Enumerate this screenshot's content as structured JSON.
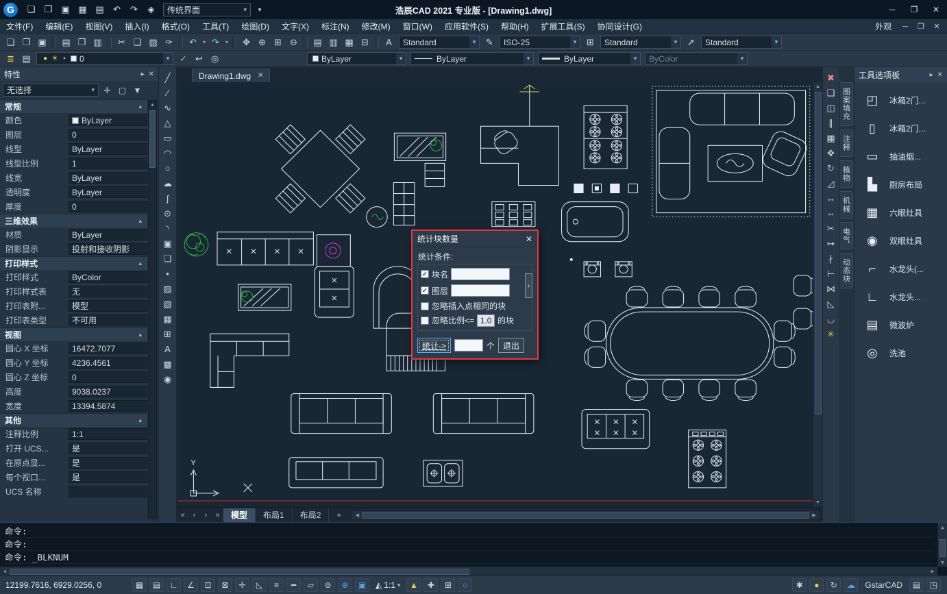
{
  "app": {
    "logo_letter": "G",
    "title": "浩辰CAD 2021 专业版 - [Drawing1.dwg]",
    "workspace": "传统界面"
  },
  "colors": {
    "accent_blue": "#2f80d0",
    "dialog_border_red": "#e03a3a",
    "canvas_background": "#192735",
    "canvas_line": "#e6edf4",
    "plant_green": "#2fae3c",
    "swirl_magenta": "#c03cc0",
    "status_bulb_yellow": "#f2cf4a",
    "red_line": "#cc2a2a"
  },
  "glyphs": {
    "chevron_down": "▾",
    "chevron_up": "▴",
    "close": "✕",
    "minimize": "─",
    "maximize": "❐",
    "pin": "▸",
    "overflow": "▾",
    "check": "✓",
    "expand": "›",
    "up": "▲",
    "down": "▼",
    "left": "◀",
    "right": "▶"
  },
  "titlebar_icons": [
    {
      "name": "new-file-icon",
      "glyph": "❏"
    },
    {
      "name": "open-file-icon",
      "glyph": "❐"
    },
    {
      "name": "save-icon",
      "glyph": "▣"
    },
    {
      "name": "save-as-icon",
      "glyph": "▦"
    },
    {
      "name": "plot-icon",
      "glyph": "▤"
    },
    {
      "name": "undo-icon",
      "glyph": "↶"
    },
    {
      "name": "redo-icon",
      "glyph": "↷"
    },
    {
      "name": "workspace-icon",
      "glyph": "◈"
    }
  ],
  "menubar": {
    "items": [
      "文件(F)",
      "编辑(E)",
      "视图(V)",
      "插入(I)",
      "格式(O)",
      "工具(T)",
      "绘图(D)",
      "文字(X)",
      "标注(N)",
      "修改(M)",
      "窗口(W)",
      "应用软件(S)",
      "帮助(H)",
      "扩展工具(S)",
      "协同设计(G)"
    ],
    "right_label": "外观"
  },
  "toolbar1": {
    "icons": [
      {
        "name": "new-file-icon",
        "glyph": "❏"
      },
      {
        "name": "open-file-icon",
        "glyph": "❐"
      },
      {
        "name": "save-icon",
        "glyph": "▣"
      },
      {
        "name": "toolbar-separator",
        "glyph": "",
        "cls": "sep"
      },
      {
        "name": "plot-icon",
        "glyph": "▤"
      },
      {
        "name": "plot-preview-icon",
        "glyph": "❒"
      },
      {
        "name": "publish-icon",
        "glyph": "▥"
      },
      {
        "name": "toolbar-separator",
        "glyph": "",
        "cls": "sep"
      },
      {
        "name": "cut-icon",
        "glyph": "✂"
      },
      {
        "name": "copy-icon",
        "glyph": "❑"
      },
      {
        "name": "paste-icon",
        "glyph": "▨"
      },
      {
        "name": "match-properties-icon",
        "glyph": "✑"
      },
      {
        "name": "toolbar-separator",
        "glyph": "",
        "cls": "sep"
      },
      {
        "name": "undo-icon",
        "glyph": "↶",
        "color": "#8fd0f0"
      },
      {
        "name": "undo-dropdown-icon",
        "glyph": "▾",
        "cls": "tiny"
      },
      {
        "name": "redo-icon",
        "glyph": "↷",
        "color": "#8fd0f0"
      },
      {
        "name": "redo-dropdown-icon",
        "glyph": "▾",
        "cls": "tiny"
      },
      {
        "name": "toolbar-separator",
        "glyph": "",
        "cls": "sep"
      },
      {
        "name": "pan-icon",
        "glyph": "✥"
      },
      {
        "name": "zoom-realtime-icon",
        "glyph": "⊕"
      },
      {
        "name": "zoom-window-icon",
        "glyph": "⊞"
      },
      {
        "name": "zoom-previous-icon",
        "glyph": "⊖"
      },
      {
        "name": "toolbar-separator",
        "glyph": "",
        "cls": "sep"
      },
      {
        "name": "properties-palette-icon",
        "glyph": "▤"
      },
      {
        "name": "tool-palettes-icon",
        "glyph": "▥"
      },
      {
        "name": "design-center-icon",
        "glyph": "▦"
      },
      {
        "name": "quick-calc-icon",
        "glyph": "⊟"
      },
      {
        "name": "toolbar-separator",
        "glyph": "",
        "cls": "sep"
      }
    ],
    "combos": [
      {
        "name": "text-style-combo",
        "icon_name": "text-style-icon",
        "icon": "A",
        "value": "Standard"
      },
      {
        "name": "dim-style-combo",
        "icon_name": "dim-style-icon",
        "icon": "✎",
        "value": "ISO-25"
      },
      {
        "name": "table-style-combo",
        "icon_name": "table-style-icon",
        "icon": "⊞",
        "value": "Standard"
      },
      {
        "name": "mleader-style-combo",
        "icon_name": "mleader-style-icon",
        "icon": "➚",
        "value": "Standard"
      }
    ]
  },
  "toolbar2": {
    "icons_left": [
      {
        "name": "layer-properties-icon",
        "glyph": "≣",
        "color": "#e8c85a"
      },
      {
        "name": "layer-states-icon",
        "glyph": "▤"
      }
    ],
    "layer_combo": {
      "bulb_icon": "●",
      "sun_icon": "☀",
      "lock_icon": "▪",
      "value": "0"
    },
    "icons_mid": [
      {
        "name": "make-object-layer-current-icon",
        "glyph": "✓",
        "color": "#7ac87a"
      },
      {
        "name": "layer-previous-icon",
        "glyph": "↩"
      },
      {
        "name": "layer-isolate-icon",
        "glyph": "◎"
      }
    ],
    "color_combo": {
      "value": "ByLayer"
    },
    "linetype_combo": {
      "value": "ByLayer"
    },
    "lineweight_combo": {
      "value": "ByLayer"
    },
    "plotstyle_combo": {
      "value": "ByColor"
    }
  },
  "properties": {
    "title": "特性",
    "selection": "无选择",
    "selector_icons": [
      {
        "name": "toggle-pickadd-icon",
        "glyph": "✛"
      },
      {
        "name": "select-objects-icon",
        "glyph": "▢"
      },
      {
        "name": "quick-select-icon",
        "glyph": "▼"
      }
    ],
    "sections": [
      {
        "title": "常规",
        "rows": [
          {
            "label": "颜色",
            "value": "ByLayer"
          },
          {
            "label": "图层",
            "value": "0"
          },
          {
            "label": "线型",
            "value": "ByLayer"
          },
          {
            "label": "线型比例",
            "value": "1"
          },
          {
            "label": "线宽",
            "value": "ByLayer"
          },
          {
            "label": "透明度",
            "value": "ByLayer"
          },
          {
            "label": "厚度",
            "value": "0"
          }
        ]
      },
      {
        "title": "三维效果",
        "rows": [
          {
            "label": "材质",
            "value": "ByLayer"
          },
          {
            "label": "阴影显示",
            "value": "投射和接收阴影"
          }
        ]
      },
      {
        "title": "打印样式",
        "rows": [
          {
            "label": "打印样式",
            "value": "ByColor"
          },
          {
            "label": "打印样式表",
            "value": "无"
          },
          {
            "label": "打印表附...",
            "value": "模型"
          },
          {
            "label": "打印表类型",
            "value": "不可用"
          }
        ]
      },
      {
        "title": "视图",
        "rows": [
          {
            "label": "圆心 X 坐标",
            "value": "16472.7077"
          },
          {
            "label": "圆心 Y 坐标",
            "value": "4236.4561"
          },
          {
            "label": "圆心 Z 坐标",
            "value": "0"
          },
          {
            "label": "高度",
            "value": "9038.0237"
          },
          {
            "label": "宽度",
            "value": "13394.5874"
          }
        ]
      },
      {
        "title": "其他",
        "rows": [
          {
            "label": "注释比例",
            "value": "1:1"
          },
          {
            "label": "打开 UCS...",
            "value": "是"
          },
          {
            "label": "在原点显...",
            "value": "是"
          },
          {
            "label": "每个视口...",
            "value": "是"
          },
          {
            "label": "UCS 名称",
            "value": ""
          }
        ]
      }
    ]
  },
  "draw_toolbar": [
    {
      "name": "line-icon",
      "glyph": "╱"
    },
    {
      "name": "construction-line-icon",
      "glyph": "∕"
    },
    {
      "name": "polyline-icon",
      "glyph": "∿"
    },
    {
      "name": "polygon-icon",
      "glyph": "△"
    },
    {
      "name": "rectangle-icon",
      "glyph": "▭"
    },
    {
      "name": "arc-icon",
      "glyph": "◠"
    },
    {
      "name": "circle-icon",
      "glyph": "○"
    },
    {
      "name": "revision-cloud-icon",
      "glyph": "☁"
    },
    {
      "name": "spline-icon",
      "glyph": "∫"
    },
    {
      "name": "ellipse-icon",
      "glyph": "⊙"
    },
    {
      "name": "ellipse-arc-icon",
      "glyph": "◝"
    },
    {
      "name": "insert-block-icon",
      "glyph": "▣"
    },
    {
      "name": "make-block-icon",
      "glyph": "❏"
    },
    {
      "name": "point-icon",
      "glyph": "•"
    },
    {
      "name": "hatch-icon",
      "glyph": "▨"
    },
    {
      "name": "gradient-icon",
      "glyph": "▧"
    },
    {
      "name": "region-icon",
      "glyph": "▦"
    },
    {
      "name": "table-icon",
      "glyph": "⊞"
    },
    {
      "name": "mtext-icon",
      "glyph": "A"
    },
    {
      "name": "wipeout-icon",
      "glyph": "▩"
    },
    {
      "name": "donut-icon",
      "glyph": "◉"
    }
  ],
  "modify_toolbar": [
    {
      "name": "erase-icon",
      "glyph": "✖",
      "color": "#e88888"
    },
    {
      "name": "copy-icon",
      "glyph": "❑"
    },
    {
      "name": "mirror-icon",
      "glyph": "◫"
    },
    {
      "name": "offset-icon",
      "glyph": "∥"
    },
    {
      "name": "array-icon",
      "glyph": "▦"
    },
    {
      "name": "move-icon",
      "glyph": "✥"
    },
    {
      "name": "rotate-icon",
      "glyph": "↻",
      "color": "#88c8f0"
    },
    {
      "name": "scale-icon",
      "glyph": "◿"
    },
    {
      "name": "stretch-icon",
      "glyph": "↔"
    },
    {
      "name": "lengthen-icon",
      "glyph": "⇔"
    },
    {
      "name": "trim-icon",
      "glyph": "✂"
    },
    {
      "name": "extend-icon",
      "glyph": "↦"
    },
    {
      "name": "break-point-icon",
      "glyph": "∤"
    },
    {
      "name": "break-icon",
      "glyph": "⊢"
    },
    {
      "name": "join-icon",
      "glyph": "⋈"
    },
    {
      "name": "chamfer-icon",
      "glyph": "◺"
    },
    {
      "name": "fillet-icon",
      "glyph": "◡"
    },
    {
      "name": "explode-icon",
      "glyph": "✳",
      "color": "#e8c85a"
    }
  ],
  "canvas": {
    "tab_label": "Drawing1.dwg"
  },
  "dialog": {
    "title": "统计块数量",
    "condition_label": "统计条件:",
    "block_name": {
      "label": "块名",
      "checked": true,
      "value": ""
    },
    "layer": {
      "label": "图层",
      "checked": true,
      "value": ""
    },
    "ignore_insert": {
      "label": "忽略插入点相同的块",
      "checked": false
    },
    "ignore_scale": {
      "label_prefix": "忽略比例<=",
      "scale_value": "1.0",
      "label_suffix": "的块",
      "checked": false
    },
    "count_button": "统计->",
    "count_value": "",
    "unit_label": "个",
    "exit_button": "退出"
  },
  "layoutbar": {
    "nav": [
      {
        "name": "first-layout-icon",
        "glyph": "«"
      },
      {
        "name": "prev-layout-icon",
        "glyph": "‹"
      },
      {
        "name": "next-layout-icon",
        "glyph": "›"
      },
      {
        "name": "last-layout-icon",
        "glyph": "»"
      }
    ],
    "tabs": [
      "模型",
      "布局1",
      "布局2"
    ],
    "add": "+"
  },
  "palette": {
    "title": "工具选项板",
    "tabs": [
      "图案填充",
      "注释",
      "植物",
      "机械",
      "电气",
      "动态块"
    ],
    "items": [
      {
        "label": "冰箱2门...",
        "icon_name": "fridge-2door-icon",
        "glyph": "◰"
      },
      {
        "label": "冰箱2门...",
        "icon_name": "fridge-2door-side-icon",
        "glyph": "▯"
      },
      {
        "label": "抽油烟...",
        "icon_name": "range-hood-icon",
        "glyph": "▭"
      },
      {
        "label": "厨房布局",
        "icon_name": "kitchen-layout-icon",
        "glyph": "▙"
      },
      {
        "label": "六眼灶具",
        "icon_name": "six-burner-stove-icon",
        "glyph": "▦"
      },
      {
        "label": "双眼灶具",
        "icon_name": "two-burner-stove-icon",
        "glyph": "◉"
      },
      {
        "label": "水龙头(...",
        "icon_name": "faucet-icon",
        "glyph": "⌐"
      },
      {
        "label": "水龙头...",
        "icon_name": "faucet-side-icon",
        "glyph": "∟"
      },
      {
        "label": "微波炉",
        "icon_name": "microwave-icon",
        "glyph": "▤"
      },
      {
        "label": "洗池",
        "icon_name": "sink-icon",
        "glyph": "◎"
      }
    ]
  },
  "command": {
    "lines": [
      "命令:",
      "命令:",
      "命令: _BLKNUM"
    ]
  },
  "status": {
    "coords": "12199.7616, 6929.0256, 0",
    "left_icons": [
      {
        "name": "snap-mode-icon",
        "glyph": "▦"
      },
      {
        "name": "grid-display-icon",
        "glyph": "▤"
      },
      {
        "name": "ortho-mode-icon",
        "glyph": "∟"
      },
      {
        "name": "polar-tracking-icon",
        "glyph": "∠"
      },
      {
        "name": "object-snap-icon",
        "glyph": "⊡"
      },
      {
        "name": "object-snap-3d-icon",
        "glyph": "⊠"
      },
      {
        "name": "object-track-icon",
        "glyph": "✛"
      },
      {
        "name": "dynamic-ucs-icon",
        "glyph": "◺"
      },
      {
        "name": "dynamic-input-icon",
        "glyph": "≡"
      },
      {
        "name": "lineweight-display-icon",
        "glyph": "━"
      },
      {
        "name": "transparency-icon",
        "glyph": "▱"
      },
      {
        "name": "selection-cycling-icon",
        "glyph": "⊜"
      },
      {
        "name": "viewport-maximize-icon",
        "glyph": "⊕",
        "color": "#4ba3e8"
      },
      {
        "name": "model-space-icon",
        "glyph": "▣",
        "color": "#4ba3e8"
      }
    ],
    "scale_icon": "◭",
    "scale_value": "1:1",
    "mid_icons": [
      {
        "name": "annotation-visibility-icon",
        "glyph": "▲",
        "color": "#e8c85a"
      },
      {
        "name": "auto-annotation-icon",
        "glyph": "✚"
      },
      {
        "name": "hardware-acceleration-icon",
        "glyph": "⊞"
      },
      {
        "name": "isolate-objects-icon",
        "glyph": "◌"
      }
    ],
    "right_icons": [
      {
        "name": "settings-gear-icon",
        "glyph": "✱"
      },
      {
        "name": "tips-bulb-icon",
        "glyph": "●",
        "color": "#f2cf4a"
      },
      {
        "name": "update-icon",
        "glyph": "↻"
      },
      {
        "name": "cloud-sync-icon",
        "glyph": "☁",
        "color": "#4ba3e8"
      }
    ],
    "brand": "GstarCAD",
    "right_icons2": [
      {
        "name": "tray-icon",
        "glyph": "▤"
      },
      {
        "name": "fullscreen-icon",
        "glyph": "◳"
      }
    ]
  }
}
